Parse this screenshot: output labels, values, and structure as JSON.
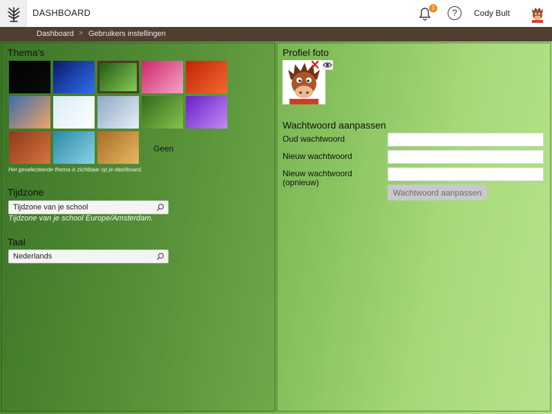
{
  "header": {
    "app_title": "DASHBOARD",
    "notification_count": "1",
    "help_symbol": "?",
    "user_name": "Cody Bult"
  },
  "breadcrumb": {
    "items": [
      "Dashboard",
      "Gebruikers instellingen"
    ],
    "separator": ">"
  },
  "themes": {
    "title": "Thema's",
    "tiles": [
      {
        "name": "black",
        "colors": [
          "#000000",
          "#0c0c0c"
        ]
      },
      {
        "name": "blue-light",
        "colors": [
          "#0a1a6a",
          "#2f6ff0"
        ]
      },
      {
        "name": "green",
        "colors": [
          "#1c5210",
          "#8cd25a"
        ],
        "selected": true
      },
      {
        "name": "pink",
        "colors": [
          "#d0266c",
          "#f4a3c6"
        ]
      },
      {
        "name": "red-flower",
        "colors": [
          "#c2220c",
          "#f26b2a"
        ]
      },
      {
        "name": "blur-sunset",
        "colors": [
          "#3a6ea8",
          "#f2a36a"
        ]
      },
      {
        "name": "white-blue",
        "colors": [
          "#d8ecf6",
          "#ffffff"
        ]
      },
      {
        "name": "clouds",
        "colors": [
          "#8fa8c8",
          "#e8eef6"
        ]
      },
      {
        "name": "grass",
        "colors": [
          "#2f6a1a",
          "#88c24c"
        ]
      },
      {
        "name": "purple",
        "colors": [
          "#6a1fc8",
          "#c18af4"
        ]
      },
      {
        "name": "brick",
        "colors": [
          "#8a3b1a",
          "#d8733f"
        ]
      },
      {
        "name": "sea",
        "colors": [
          "#2a8aa8",
          "#8ad2e4"
        ]
      },
      {
        "name": "bamboo",
        "colors": [
          "#a86c24",
          "#e6b865"
        ]
      }
    ],
    "none_label": "Geen",
    "hint": "Het geselecteerde thema is zichtbaar op je dashboard."
  },
  "timezone": {
    "title": "Tijdzone",
    "value": "Tijdzone van je school",
    "note": "Tijdzone van je school Europe/Amsterdam."
  },
  "language": {
    "title": "Taal",
    "value": "Nederlands"
  },
  "profile": {
    "title": "Profiel foto"
  },
  "password": {
    "title": "Wachtwoord aanpassen",
    "old_label": "Oud wachtwoord",
    "new_label": "Nieuw wachtwoord",
    "repeat_label_1": "Nieuw wachtwoord",
    "repeat_label_2": "(opnieuw)",
    "old_value": "",
    "new_value": "",
    "repeat_value": "",
    "submit_label": "Wachtwoord aanpassen"
  },
  "colors": {
    "accent_badge": "#f08a24",
    "breadcrumb_bg": "#4f3f31"
  }
}
